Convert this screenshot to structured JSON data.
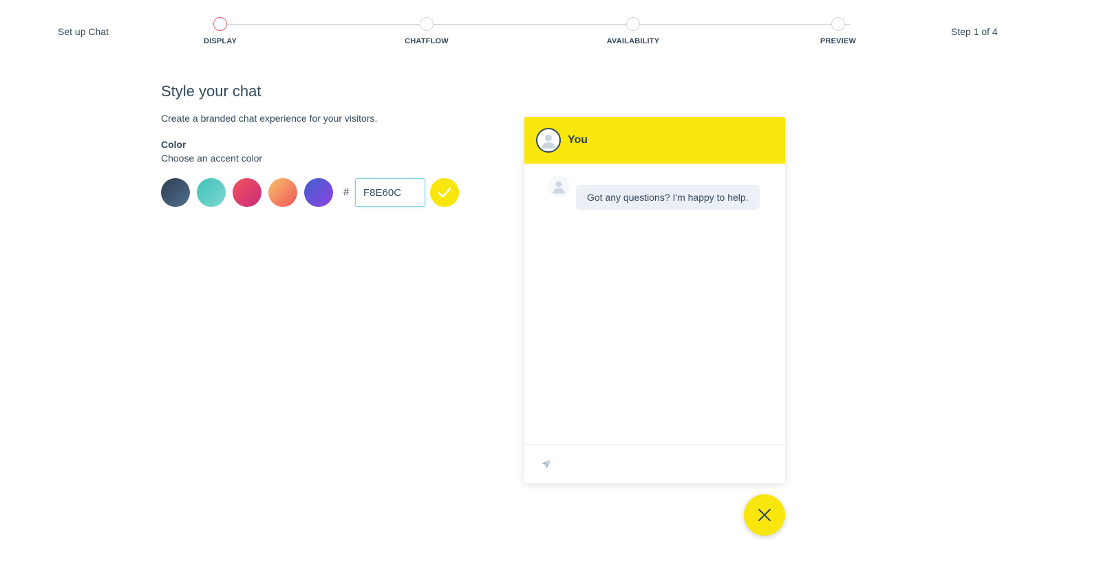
{
  "header": {
    "title": "Set up Chat",
    "step_count": "Step 1 of 4"
  },
  "stepper": {
    "steps": [
      {
        "label": "DISPLAY",
        "active": true
      },
      {
        "label": "CHATFLOW",
        "active": false
      },
      {
        "label": "AVAILABILITY",
        "active": false
      },
      {
        "label": "PREVIEW",
        "active": false
      }
    ]
  },
  "main": {
    "title": "Style your chat",
    "subtitle": "Create a branded chat experience for your visitors.",
    "color_label": "Color",
    "color_hint": "Choose an accent color"
  },
  "colors": {
    "hash_symbol": "#",
    "hex_value": "F8E60C",
    "selected": "#F8E60C",
    "presets": [
      {
        "name": "slate",
        "from": "#2d3e50",
        "to": "#516f90"
      },
      {
        "name": "teal",
        "from": "#3ec1b7",
        "to": "#7fd8d2"
      },
      {
        "name": "pink",
        "from": "#f2545b",
        "to": "#c92c7d"
      },
      {
        "name": "orange",
        "from": "#f5c26b",
        "to": "#f2545b"
      },
      {
        "name": "purple",
        "from": "#3e5ecf",
        "to": "#8e44e0"
      }
    ]
  },
  "preview": {
    "header_name": "You",
    "greeting": "Got any questions? I'm happy to help.",
    "accent": "#F8E60C"
  },
  "icons": {
    "selected_check": "check-icon",
    "send": "paper-plane-icon",
    "close": "close-icon",
    "avatar": "user-avatar-icon"
  }
}
